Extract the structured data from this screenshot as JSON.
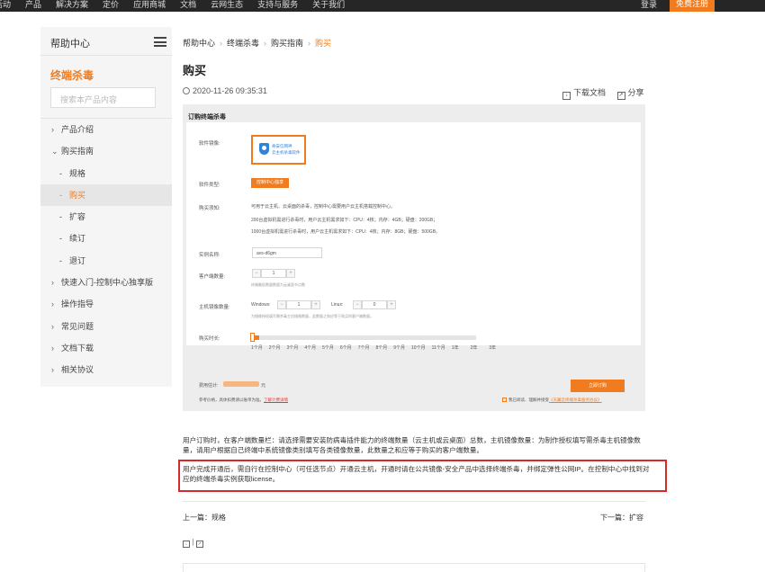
{
  "topbar": {
    "nav": [
      "活动",
      "产品",
      "解决方案",
      "定价",
      "应用商城",
      "文档",
      "云网生态",
      "支持与服务",
      "关于我们"
    ],
    "login": "登录",
    "register": "免费注册"
  },
  "sidebar": {
    "title": "帮助中心",
    "product": "终端杀毒",
    "search_placeholder": "搜索本产品内容",
    "items": [
      {
        "label": "产品介绍",
        "chevron": "›"
      },
      {
        "label": "购买指南",
        "chevron": "⌄"
      },
      {
        "label": "规格",
        "dash": "-"
      },
      {
        "label": "购买",
        "dash": "-"
      },
      {
        "label": "扩容",
        "dash": "-"
      },
      {
        "label": "续订",
        "dash": "-"
      },
      {
        "label": "退订",
        "dash": "-"
      },
      {
        "label": "快速入门-控制中心独享版",
        "chevron": "›"
      },
      {
        "label": "操作指导",
        "chevron": "›"
      },
      {
        "label": "常见问题",
        "chevron": "›"
      },
      {
        "label": "文档下载",
        "chevron": "›"
      },
      {
        "label": "相关协议",
        "chevron": "›"
      }
    ]
  },
  "breadcrumb": {
    "items": [
      "帮助中心",
      "终端杀毒",
      "购买指南"
    ],
    "current": "购买",
    "sep": "›"
  },
  "page": {
    "title": "购买",
    "date": "2020-11-26 09:35:31",
    "download": "下载文档",
    "share": "分享"
  },
  "panel": {
    "title": "订购终端杀毒",
    "labels": {
      "mirror": "软件镜像:",
      "type": "软件类型:",
      "notice": "购买须知:",
      "instance": "实例名称:",
      "clients": "客户端数量:",
      "hosts": "主机镜像数量:",
      "duration": "购买时长:"
    },
    "mirror_lines": [
      "奇安信网神",
      "云主机杀毒软件"
    ],
    "type_button": "控制中心独享",
    "notice_lines": [
      "可用于云主机、云桌面的杀毒，控制中心需要用户云主机搭载控制中心。",
      "200台虚拟机需进行杀毒时，用户云主机需求如下：CPU：4核；内存：4GB；硬盘：200GB；",
      "1000台虚拟机需进行杀毒时，用户云主机需求如下：CPU：4核；内存：8GB；硬盘：500GB。"
    ],
    "instance_value": "avs-d6gm",
    "clients_value": "1",
    "clients_hint": "终端最低数量数量为云桌面节点数",
    "windows_label": "Windows:",
    "windows_value": "1",
    "linux_label": "Linux:",
    "linux_value": "0",
    "hosts_hint": "为镜像授权填写需杀毒主机镜像数量，此数量之和应等于购买的客户端数量。",
    "durations": [
      "1个月",
      "2个月",
      "3个月",
      "4个月",
      "5个月",
      "6个月",
      "7个月",
      "8个月",
      "9个月",
      "10个月",
      "11个月",
      "1年",
      "2年",
      "3年"
    ],
    "duration_progress": 0.04,
    "price_label": "费用估计:",
    "price_unit": "元",
    "ref_text": "参考价格，具体扣费请以账单为准。",
    "ref_link": "了解计费详情",
    "order_button": "立即订购",
    "agree_text": "我已阅读、理解并接受",
    "agree_link": "《天翼云终端杀毒服务协议》"
  },
  "content": {
    "para1": "用户订购时，在客户端数量栏：请选择需要安装防病毒插件能力的终端数量（云主机或云桌面）总数，主机镜像数量：为制作授权填写需杀毒主机镜像数量，请用户根据自己终端中系统镜像类别填写各类镜像数量，此数量之和应等于购买的客户端数量。",
    "para2": "用户完成开通后，需自行在控制中心（可任选节点）开通云主机，开通时请在公共镜像-安全产品中选择终端杀毒，并绑定弹性公网IP。在控制中心中找到对应的终端杀毒实例获取license。",
    "prev": "上一篇：规格",
    "next": "下一篇：扩容"
  },
  "colors": {
    "accent": "#f07c1f",
    "highlight": "#d42a2a",
    "topbar": "#262626"
  }
}
